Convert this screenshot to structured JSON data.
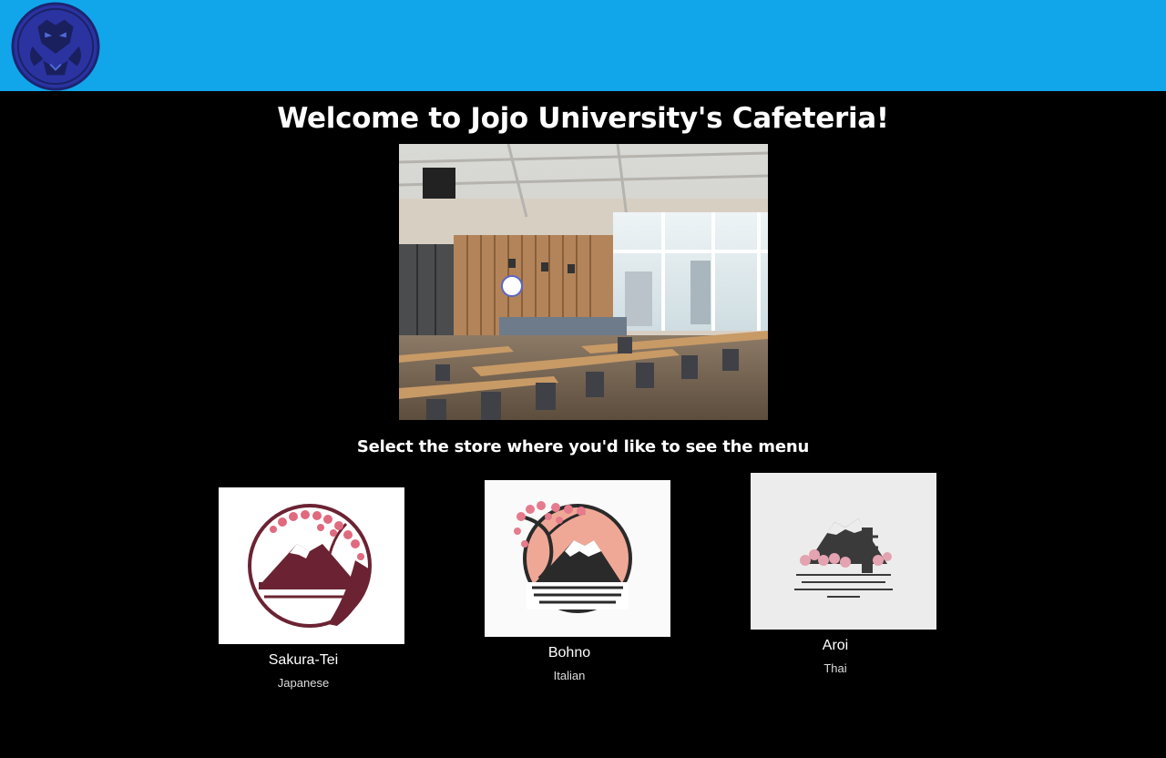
{
  "header": {
    "logo_icon": "jojo-university-emblem-icon",
    "background_color": "#11a6ea",
    "logo_color": "#25307a"
  },
  "main": {
    "title": "Welcome to Jojo University's Cafeteria!",
    "hero_image": "cafeteria-interior-photo",
    "subtitle": "Select the store where you'd like to see the menu"
  },
  "stores": [
    {
      "name": "Sakura-Tei",
      "cuisine": "Japanese",
      "logo_icon": "sakura-mountain-logo-icon"
    },
    {
      "name": "Bohno",
      "cuisine": "Italian",
      "logo_icon": "cherry-blossom-fuji-logo-icon"
    },
    {
      "name": "Aroi",
      "cuisine": "Thai",
      "logo_icon": "mountain-pagoda-logo-icon"
    }
  ],
  "colors": {
    "page_background": "#000000",
    "text": "#ffffff"
  }
}
